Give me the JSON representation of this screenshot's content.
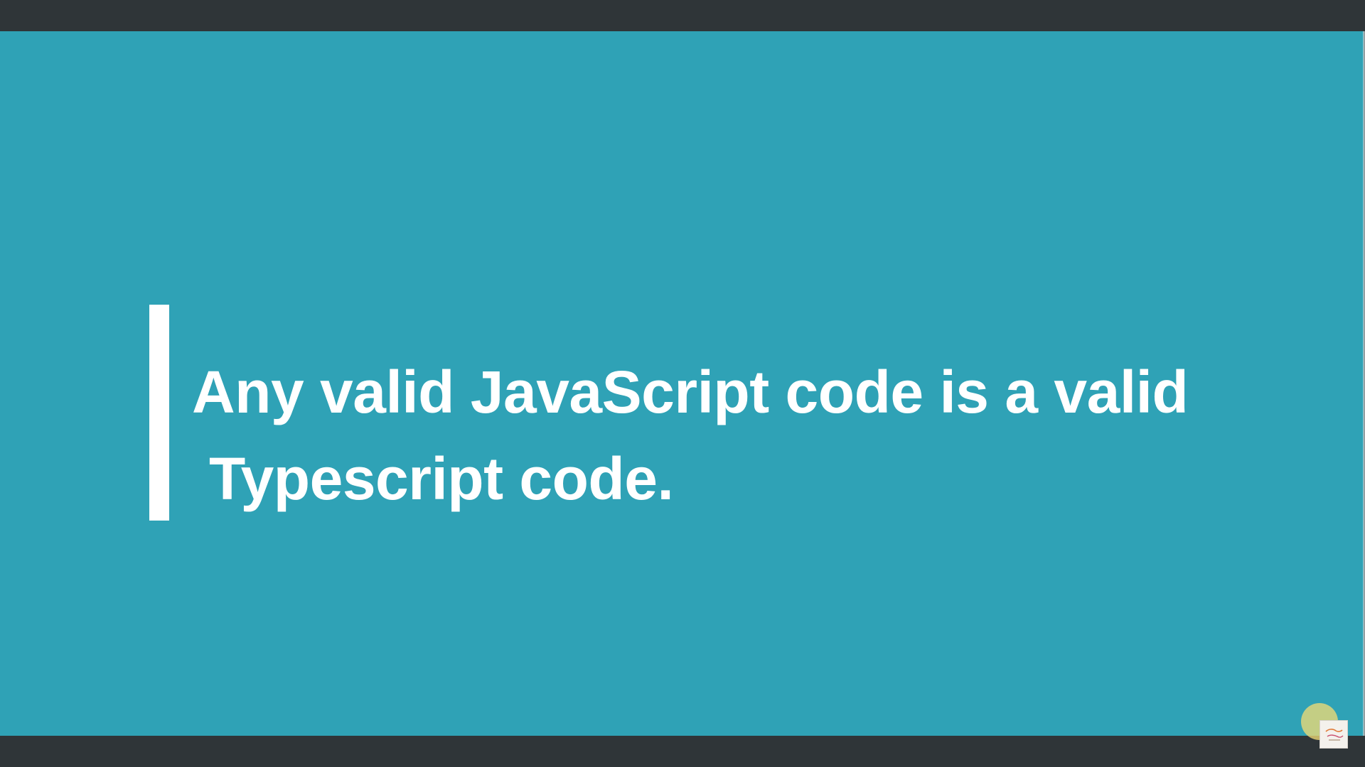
{
  "slide": {
    "line1": "Any valid JavaScript code is a valid",
    "line2": "Typescript code."
  },
  "colors": {
    "slide_background": "#2fa2b6",
    "frame_background": "#2f3538",
    "text": "#ffffff",
    "quote_bar": "#ffffff",
    "cursor_highlight": "#eeda76"
  },
  "icons": {
    "cursor": "cursor-highlight-icon",
    "watermark": "watermark-logo-icon"
  }
}
